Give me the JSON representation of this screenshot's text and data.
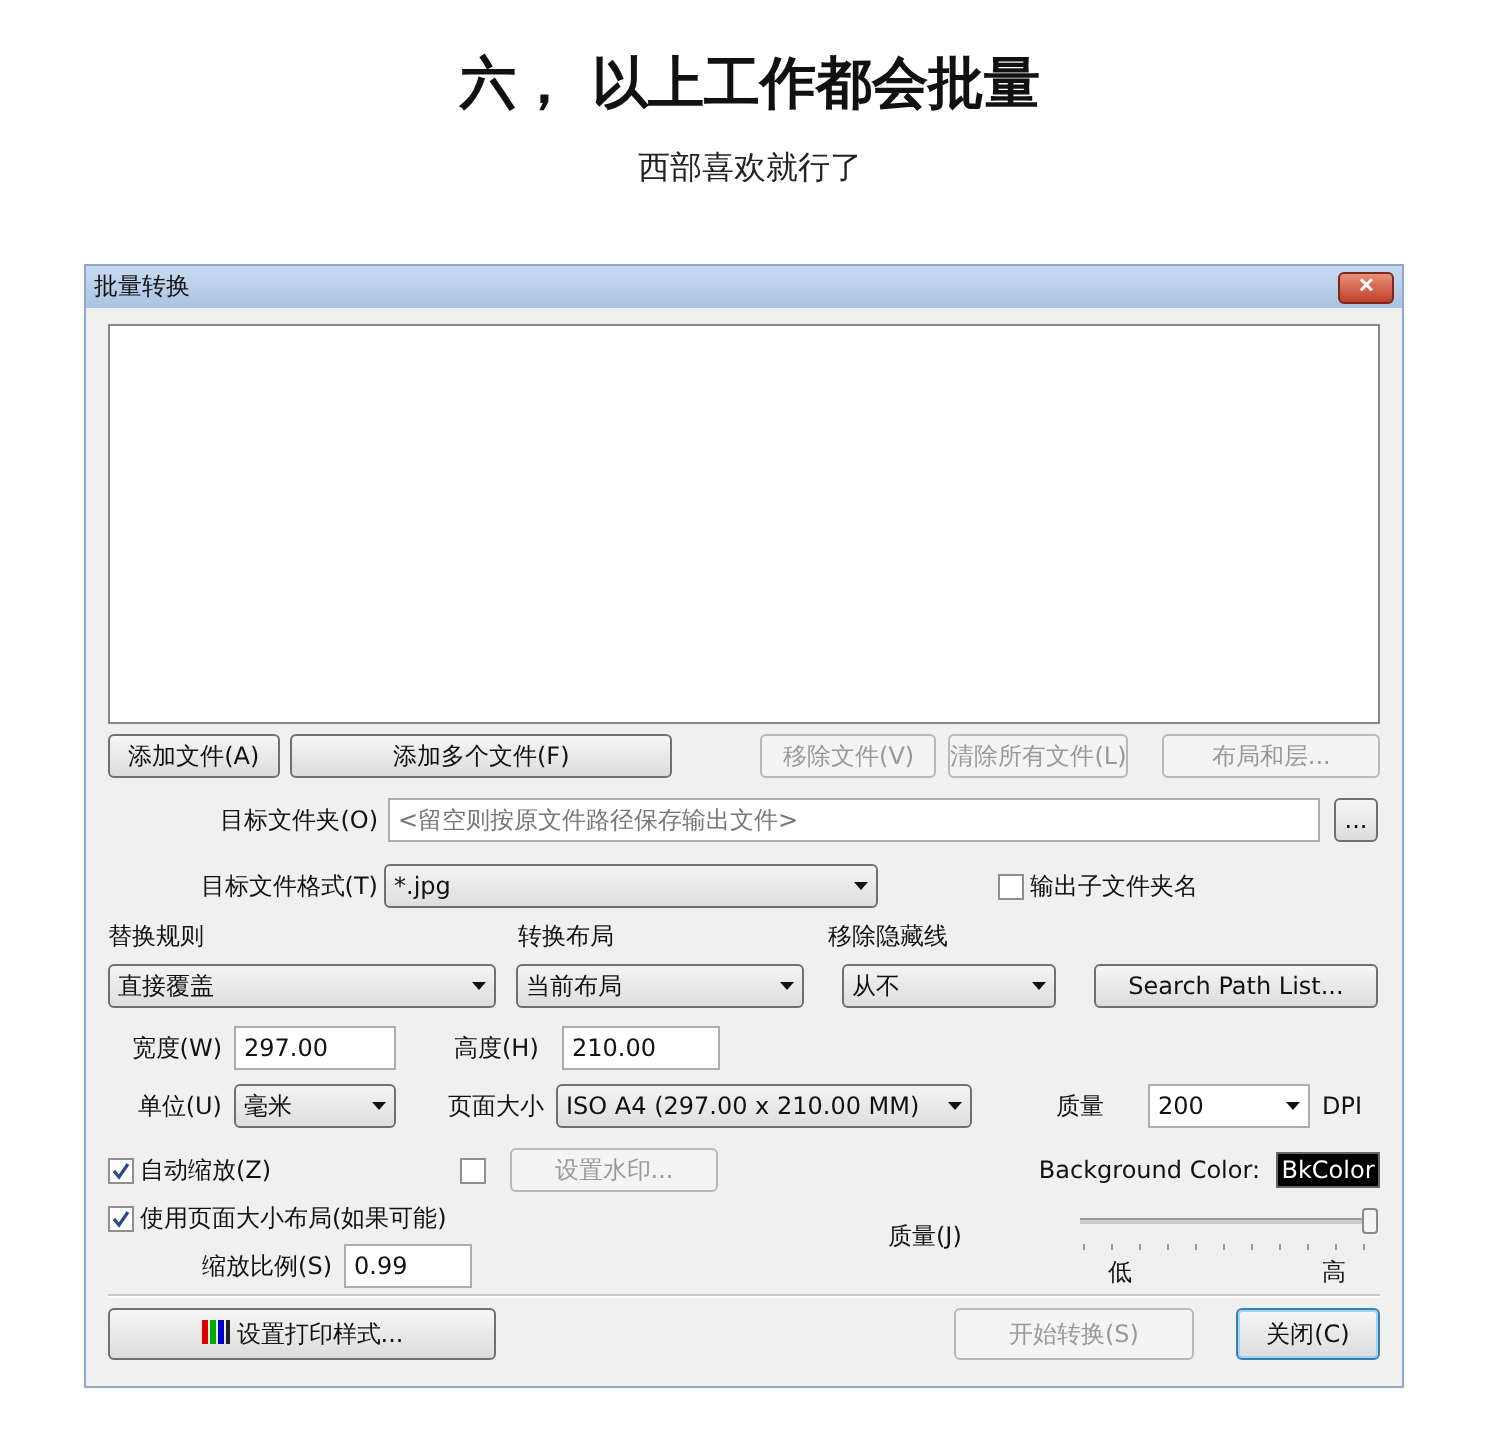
{
  "heading": "六， 以上工作都会批量",
  "subheading": "西部喜欢就行了",
  "window": {
    "title": "批量转换",
    "close": "✕"
  },
  "file_buttons": [
    {
      "label": "添加文件(A)",
      "disabled": false
    },
    {
      "label": "添加多个文件(F)",
      "disabled": false
    },
    {
      "label": "移除文件(V)",
      "disabled": true
    },
    {
      "label": "清除所有文件(L)",
      "disabled": true
    },
    {
      "label": "布局和层...",
      "disabled": true
    }
  ],
  "target_folder": {
    "label": "目标文件夹(O)",
    "placeholder": "<留空则按原文件路径保存输出文件>",
    "browse": "..."
  },
  "target_format": {
    "label": "目标文件格式(T)",
    "value": "*.jpg"
  },
  "output_subfolder": {
    "label": "输出子文件夹名",
    "checked": false
  },
  "replace_rule": {
    "label": "替换规则",
    "value": "直接覆盖"
  },
  "convert_layout": {
    "label": "转换布局",
    "value": "当前布局"
  },
  "remove_hidden_lines": {
    "label": "移除隐藏线",
    "value": "从不"
  },
  "search_path_button": "Search Path List...",
  "width": {
    "label": "宽度(W)",
    "value": "297.00"
  },
  "height": {
    "label": "高度(H)",
    "value": "210.00"
  },
  "unit": {
    "label": "单位(U)",
    "value": "毫米"
  },
  "page_size": {
    "label": "页面大小",
    "value": "ISO A4 (297.00 x 210.00 MM)"
  },
  "resolution": {
    "label": "质量",
    "value": "200",
    "unit": "DPI"
  },
  "auto_scale": {
    "label": "自动缩放(Z)",
    "checked": true
  },
  "watermark": {
    "checked": false,
    "button": "设置水印...",
    "disabled": true
  },
  "background_color": {
    "label": "Background Color:",
    "swatch": "BkColor"
  },
  "use_page_size": {
    "label": "使用页面大小布局(如果可能)",
    "checked": true
  },
  "quality": {
    "label": "质量(J)",
    "level": 1,
    "low": "低",
    "high": "高"
  },
  "scale": {
    "label": "缩放比例(S)",
    "value": "0.99"
  },
  "print_style_button": "设置打印样式...",
  "start_button": {
    "label": "开始转换(S)",
    "disabled": true
  },
  "close_button": {
    "label": "关闭(C)",
    "disabled": false
  }
}
